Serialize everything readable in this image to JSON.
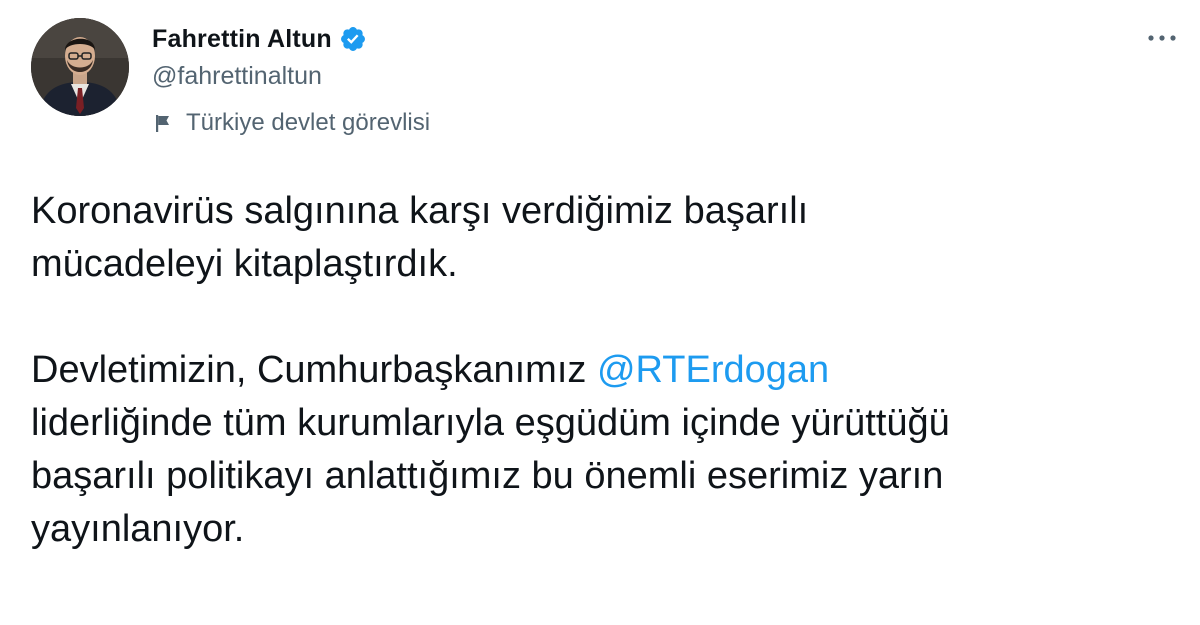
{
  "tweet": {
    "author": {
      "name": "Fahrettin Altun",
      "handle": "@fahrettinaltun",
      "verified_icon": "verified-badge-icon",
      "label": "Türkiye devlet görevlisi",
      "label_icon": "flag-icon"
    },
    "more_icon": "more-options-icon",
    "body": {
      "para1_lines": [
        "Koronavirüs salgınına karşı verdiğimiz başarılı",
        "mücadeleyi kitaplaştırdık."
      ],
      "para2_line1_before": "Devletimizin, Cumhurbaşkanımız ",
      "para2_mention": "@RTErdogan",
      "para2_lines": [
        "liderliğinde tüm kurumlarıyla eşgüdüm içinde yürüttüğü",
        "başarılı politikayı anlattığımız bu önemli eserimiz yarın",
        "yayınlanıyor."
      ]
    },
    "colors": {
      "text": "#0f1419",
      "secondary": "#536471",
      "link": "#1d9bf0",
      "verified": "#1d9bf0"
    }
  }
}
